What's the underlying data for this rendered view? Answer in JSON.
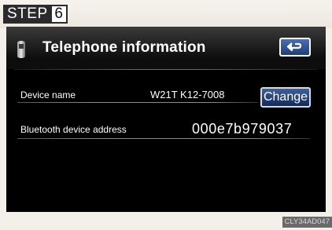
{
  "step": {
    "label": "STEP",
    "number": "6"
  },
  "header": {
    "title": "Telephone information",
    "phone_icon": "mobile-phone-icon",
    "back_icon": "return-arrow-icon"
  },
  "rows": [
    {
      "label": "Device name",
      "value": "W21T  K12-7008",
      "action_label": "Change"
    },
    {
      "label": "Bluetooth device address",
      "value": "000e7b979037"
    }
  ],
  "caption_code": "CLY34AD047",
  "colors": {
    "screen_background": "#000000",
    "button_blue": "#2d4f8e",
    "page_background": "#f3f0ea"
  }
}
